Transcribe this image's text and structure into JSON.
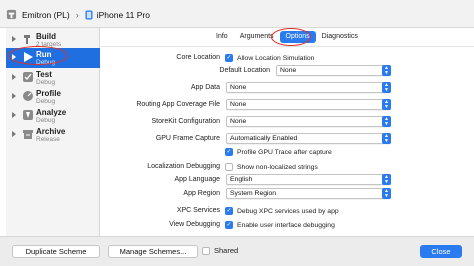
{
  "toolbar": {
    "scheme_name": "Emitron (PL)",
    "device_name": "iPhone 11 Pro",
    "chevron": "›"
  },
  "sidebar": {
    "items": [
      {
        "name": "Build",
        "sub": "2 targets",
        "icon": "hammer-icon",
        "selected": false
      },
      {
        "name": "Run",
        "sub": "Debug",
        "icon": "play-icon",
        "selected": true
      },
      {
        "name": "Test",
        "sub": "Debug",
        "icon": "wrench-icon",
        "selected": false
      },
      {
        "name": "Profile",
        "sub": "Debug",
        "icon": "gauge-icon",
        "selected": false
      },
      {
        "name": "Analyze",
        "sub": "Debug",
        "icon": "analyze-icon",
        "selected": false
      },
      {
        "name": "Archive",
        "sub": "Release",
        "icon": "archive-icon",
        "selected": false
      }
    ]
  },
  "tabs": [
    "Info",
    "Arguments",
    "Options",
    "Diagnostics"
  ],
  "active_tab": "Options",
  "options": {
    "core_location": {
      "label": "Core Location",
      "checkbox": "Allow Location Simulation",
      "checked": true
    },
    "default_location": {
      "label": "Default Location",
      "value": "None"
    },
    "app_data": {
      "label": "App Data",
      "value": "None"
    },
    "routing": {
      "label": "Routing App Coverage File",
      "value": "None"
    },
    "storekit": {
      "label": "StoreKit Configuration",
      "value": "None"
    },
    "gpu_frame": {
      "label": "GPU Frame Capture",
      "value": "Automatically Enabled"
    },
    "profile_gpu": {
      "checkbox": "Profile GPU Trace after capture",
      "checked": true
    },
    "localization": {
      "label": "Localization Debugging",
      "checkbox": "Show non-localized strings",
      "checked": false
    },
    "app_language": {
      "label": "App Language",
      "value": "English"
    },
    "app_region": {
      "label": "App Region",
      "value": "System Region"
    },
    "xpc": {
      "label": "XPC Services",
      "checkbox": "Debug XPC services used by app",
      "checked": true
    },
    "view_debugging": {
      "label": "View Debugging",
      "checkbox": "Enable user interface debugging",
      "checked": true
    }
  },
  "bottom": {
    "duplicate": "Duplicate Scheme",
    "manage": "Manage Schemes...",
    "shared": "Shared",
    "close": "Close"
  },
  "colors": {
    "accent": "#2a7af0",
    "selection": "#1f6fe0",
    "annotation": "#e0302a"
  }
}
